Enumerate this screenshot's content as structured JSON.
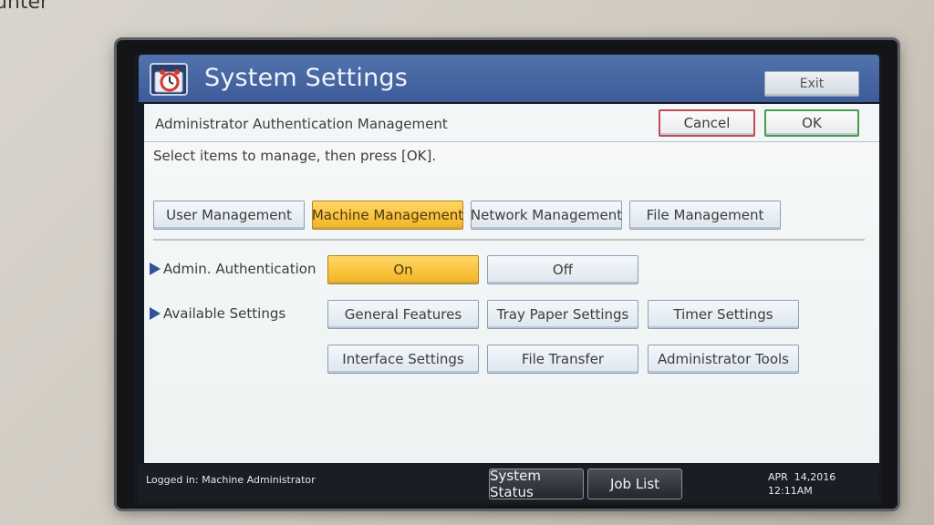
{
  "corner_text": "unter",
  "titlebar": {
    "title": "System Settings",
    "icon": "settings-clock-icon",
    "exit_label": "Exit"
  },
  "header": {
    "label": "Administrator Authentication Management",
    "cancel_label": "Cancel",
    "ok_label": "OK"
  },
  "instruction": "Select items to manage, then press [OK].",
  "categories": [
    {
      "label": "User Management",
      "selected": false
    },
    {
      "label": "Machine Management",
      "selected": true
    },
    {
      "label": "Network Management",
      "selected": false
    },
    {
      "label": "File Management",
      "selected": false
    }
  ],
  "admin_auth": {
    "label": "Admin. Authentication",
    "on_label": "On",
    "off_label": "Off",
    "selected": "On"
  },
  "available_settings": {
    "label": "Available Settings",
    "options": [
      "General Features",
      "Tray Paper Settings",
      "Timer Settings",
      "Interface Settings",
      "File Transfer",
      "Administrator Tools"
    ]
  },
  "footer": {
    "logged_in": "Logged in: Machine Administrator",
    "system_status_label": "System Status",
    "job_list_label": "Job List",
    "date": "APR  14,2016",
    "time": "12:11AM"
  },
  "colors": {
    "title_bar": "#3c5b98",
    "selected": "#f3b320",
    "cancel_border": "#c04a55",
    "ok_border": "#4c9a4f"
  }
}
